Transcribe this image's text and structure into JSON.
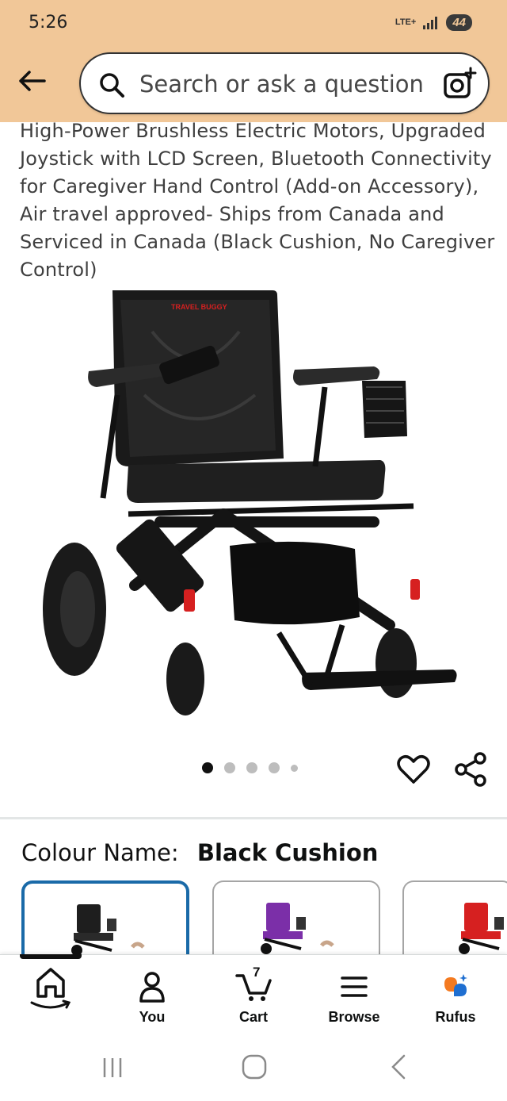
{
  "status_bar": {
    "time": "5:26",
    "network": "LTE+",
    "battery": "44"
  },
  "search": {
    "placeholder": "Search or ask a question"
  },
  "product": {
    "title": "High-Power Brushless Electric Motors, Upgraded Joystick with LCD Screen, Bluetooth Connectivity for Caregiver Hand Control (Add-on Accessory), Air travel approved- Ships from Canada and Serviced in Canada (Black Cushion, No Caregiver Control)",
    "image_brand_text": "TRAVEL BUGGY",
    "carousel": {
      "count": 5,
      "active_index": 0
    }
  },
  "colour": {
    "label": "Colour Name:",
    "value": "Black Cushion",
    "options": [
      {
        "name": "black-cushion",
        "color": "#1e1e1e",
        "selected": true
      },
      {
        "name": "purple-cushion",
        "color": "#7b2fa8",
        "selected": false
      },
      {
        "name": "red-cushion",
        "color": "#d62020",
        "selected": false
      }
    ]
  },
  "bottom_nav": {
    "items": [
      {
        "label": "",
        "icon": "home-icon"
      },
      {
        "label": "You",
        "icon": "person-icon"
      },
      {
        "label": "Cart",
        "icon": "cart-icon",
        "count": "7"
      },
      {
        "label": "Browse",
        "icon": "menu-icon"
      },
      {
        "label": "Rufus",
        "icon": "rufus-icon"
      }
    ]
  },
  "colors": {
    "header_bg": "#f1c798",
    "selected_border": "#1a6aa8",
    "rufus_orange": "#f47a20",
    "rufus_blue": "#1f6fd1"
  }
}
